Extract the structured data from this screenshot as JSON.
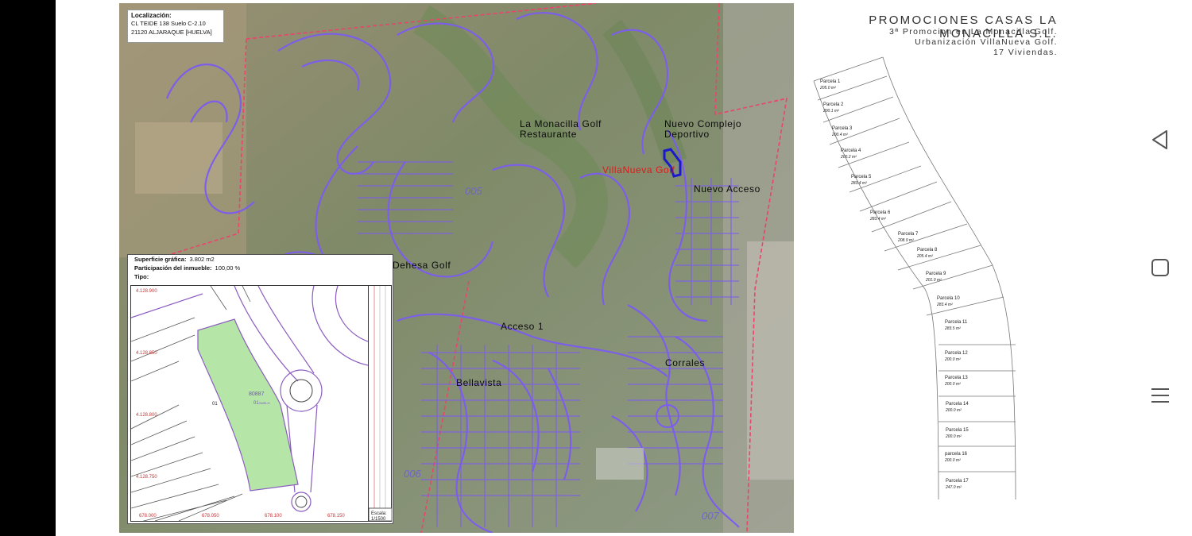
{
  "location_box": {
    "title": "Localización:",
    "line1": "CL TEIDE 138 Suelo C-2.10",
    "line2": "21120 ALJARAQUE [HUELVA]"
  },
  "map_labels": {
    "monacilla": "La Monacilla Golf",
    "restaurante": "Restaurante",
    "complejo1": "Nuevo Complejo",
    "complejo2": "Deportivo",
    "villanueva": "VillaNueva Golf",
    "nuevo_acceso": "Nuevo Acceso",
    "dehesa": "Dehesa Golf",
    "acceso1": "Acceso 1",
    "corrales": "Corrales",
    "bellavista": "Bellavista"
  },
  "zone_numbers": [
    "005",
    "006",
    "007"
  ],
  "inset": {
    "sup_label": "Superficie gráfica:",
    "sup_value": "3.802 m2",
    "part_label": "Participación del inmueble:",
    "part_value": "100,00 %",
    "tipo_label": "Tipo:",
    "parcel_id": "80887",
    "parcel_sub": "01",
    "lot": "01",
    "suelo": "SUELO",
    "y_ticks": [
      "4.128.900",
      "4.128.850",
      "4.128.800",
      "4.128.750"
    ],
    "x_ticks": [
      "678.000",
      "678.050",
      "678.100",
      "678.150"
    ],
    "escala_label": "Escala:",
    "escala_value": "1/1500"
  },
  "promo": {
    "title": "PROMOCIONES CASAS LA MONACILLA S.L.",
    "line2": "3ª Promocion en La Monacilla Golf.",
    "line3": "Urbanización VillaNueva Golf.",
    "line4": "17 Viviendas."
  },
  "parcels": [
    {
      "name": "Parcela 1",
      "area": "205.0 m²"
    },
    {
      "name": "Parcela 2",
      "area": "200.1 m²"
    },
    {
      "name": "Parcela 3",
      "area": "200.4 m²"
    },
    {
      "name": "Parcela 4",
      "area": "200.2 m²"
    },
    {
      "name": "Parcela 5",
      "area": "283.4 m²"
    },
    {
      "name": "Parcela 6",
      "area": "283.4 m²"
    },
    {
      "name": "Parcela 7",
      "area": "208.9 m²"
    },
    {
      "name": "Parcela 8",
      "area": "205.4 m²"
    },
    {
      "name": "Parcela 9",
      "area": "201.0 m²"
    },
    {
      "name": "Parcela 10",
      "area": "283.4 m²"
    },
    {
      "name": "Parcela 11",
      "area": "283.5 m²"
    },
    {
      "name": "Parcela 12",
      "area": "200.0 m²"
    },
    {
      "name": "Parcela 13",
      "area": "200.0 m²"
    },
    {
      "name": "Parcela 14",
      "area": "200.0 m²"
    },
    {
      "name": "Parcela 15",
      "area": "200.0 m²"
    },
    {
      "name": "parcela 16",
      "area": "200.0 m²"
    },
    {
      "name": "Parcela 17",
      "area": "247.0 m²"
    }
  ],
  "nav": {
    "back_icon": "triangle-back-icon",
    "home_icon": "square-home-icon",
    "menu_icon": "hamburger-menu-icon"
  },
  "colors": {
    "boundary": "#7c5cf0",
    "district": "#e8456c",
    "highlight": "#1a1acc",
    "green_parcel": "#b5e6a8"
  }
}
